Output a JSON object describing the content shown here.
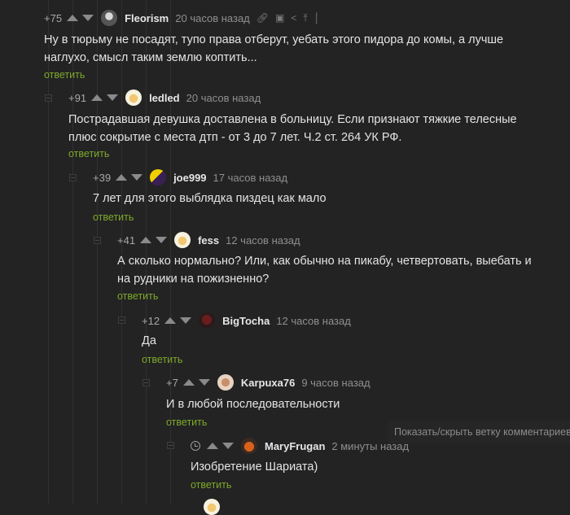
{
  "comments": [
    {
      "rating": "+75",
      "nick": "Fleorism",
      "time": "20 часов назад",
      "text": "Ну в тюрьму не посадят, тупо права отберут, уебать этого пидора до комы, а лучше наглухо, смысл таким землю коптить...",
      "reply": "ответить",
      "tools": [
        "link-icon",
        "save-icon",
        "share-icon",
        "go-up-icon",
        "more-icon"
      ]
    },
    {
      "rating": "+91",
      "nick": "ledled",
      "time": "20 часов назад",
      "text": "Пострадавшая девушка доставлена в больницу. Если признают тяжкие телесные плюс сокрытие с места дтп - от 3 до 7 лет. Ч.2 ст. 264 УК РФ.",
      "reply": "ответить"
    },
    {
      "rating": "+39",
      "nick": "joe999",
      "time": "17 часов назад",
      "text": "7 лет для этого выблядка пиздец как мало",
      "reply": "ответить"
    },
    {
      "rating": "+41",
      "nick": "fess",
      "time": "12 часов назад",
      "text": "А сколько нормально? Или, как обычно на пикабу, четвертовать, выебать и на рудники на пожизненно?",
      "reply": "ответить"
    },
    {
      "rating": "+12",
      "nick": "BigTocha",
      "time": "12 часов назад",
      "text": "Да",
      "reply": "ответить"
    },
    {
      "rating": "+7",
      "nick": "Karpuxa76",
      "time": "9 часов назад",
      "text": "И в любой последовательности",
      "reply": "ответить"
    },
    {
      "rating": "",
      "nick": "MaryFrugan",
      "time": "2 минуты назад",
      "text": "Изобретение Шариата)",
      "reply": "ответить"
    }
  ],
  "tooltip": "Показать/скрыть ветку комментариев",
  "colors": {
    "background": "#232323",
    "reply_link": "#7ea92a",
    "muted": "#8f8f8f"
  }
}
